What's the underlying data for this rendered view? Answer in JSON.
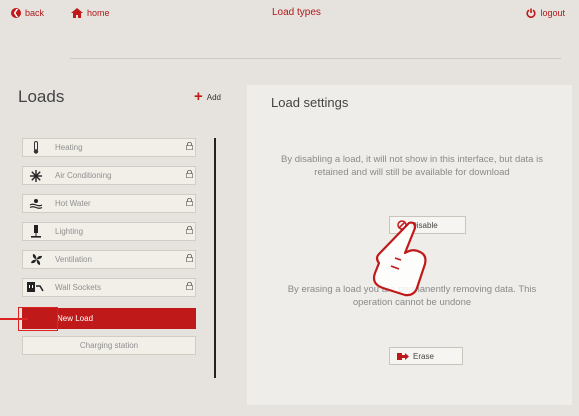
{
  "topbar": {
    "back_label": "back",
    "home_label": "home",
    "title": "Load types",
    "logout_label": "logout"
  },
  "loads": {
    "heading": "Loads",
    "add_label": "Add",
    "items": [
      {
        "label": "Heating",
        "icon": "thermometer-icon"
      },
      {
        "label": "Air Conditioning",
        "icon": "snowflake-icon"
      },
      {
        "label": "Hot Water",
        "icon": "hot-water-icon"
      },
      {
        "label": "Lighting",
        "icon": "lamp-icon"
      },
      {
        "label": "Ventilation",
        "icon": "fan-icon"
      },
      {
        "label": "Wall Sockets",
        "icon": "socket-plug-icon"
      },
      {
        "label": "New Load",
        "selected": true
      },
      {
        "label": "Charging station"
      }
    ]
  },
  "settings": {
    "heading": "Load settings",
    "disable_message": "By disabling a load, it will not show in this interface, but data is retained and will still be available for download",
    "disable_button": "Disable",
    "erase_message": "By erasing a load you are permanently removing data. This operation cannot be undone",
    "erase_button": "Erase"
  },
  "colors": {
    "accent": "#c0191a",
    "background": "#e6e3de",
    "panel": "#efede9"
  }
}
